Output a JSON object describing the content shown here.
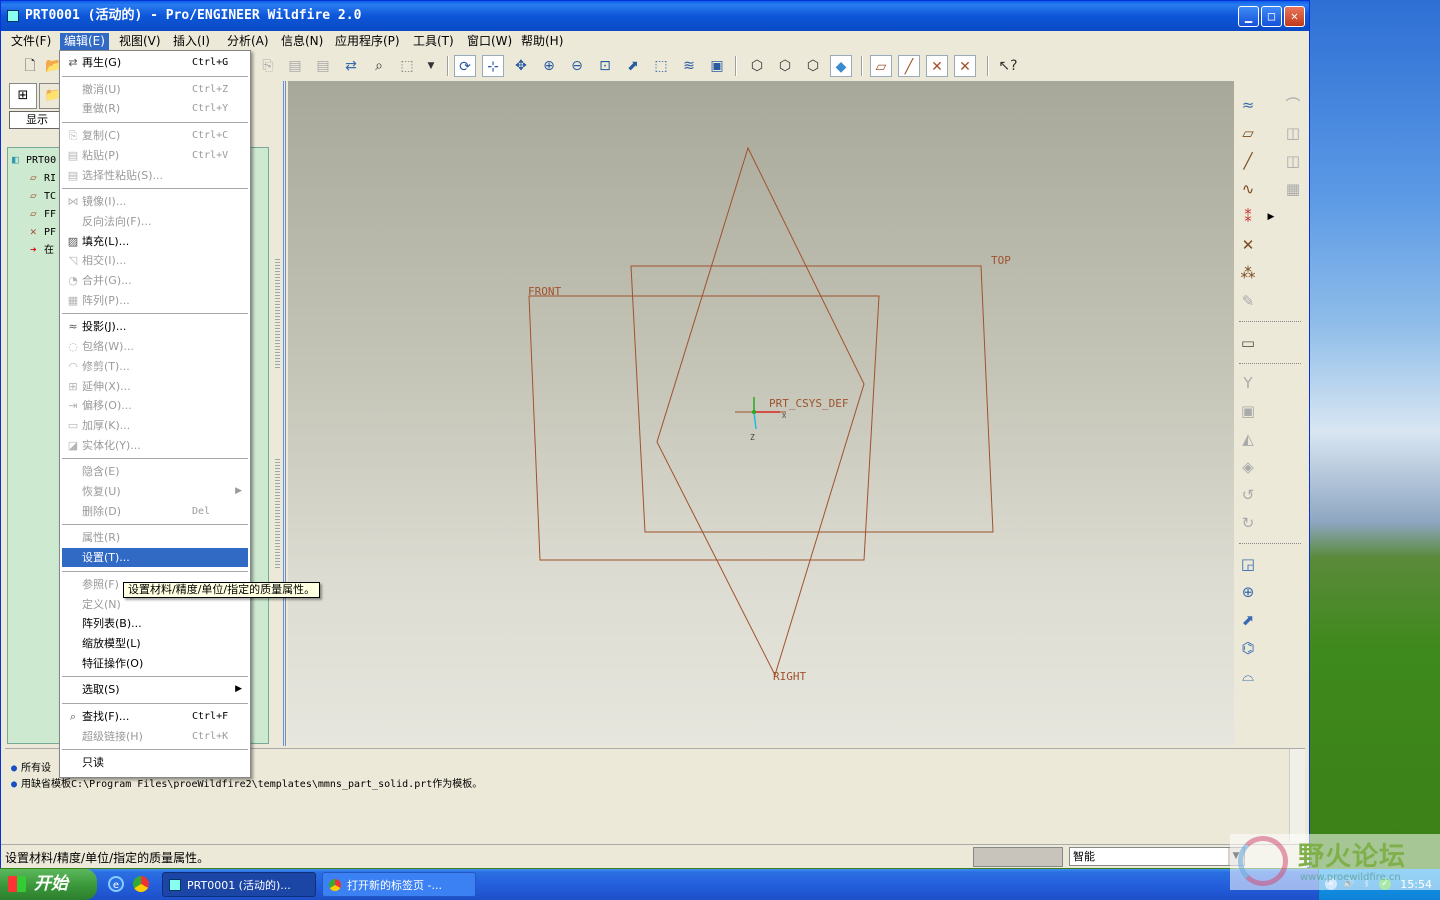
{
  "window": {
    "title": "PRT0001 (活动的) - Pro/ENGINEER Wildfire 2.0",
    "min": "▁",
    "max": "□",
    "close": "✕"
  },
  "menubar": [
    "文件(F)",
    "编辑(E)",
    "视图(V)",
    "插入(I)",
    "分析(A)",
    "信息(N)",
    "应用程序(P)",
    "工具(T)",
    "窗口(W)",
    "帮助(H)"
  ],
  "left_panel": {
    "show_button": "显示",
    "tree": [
      {
        "icon": "part-icon",
        "glyph": "◧",
        "label": "PRT00"
      },
      {
        "icon": "datum-plane-icon",
        "glyph": "▱",
        "label": "RI"
      },
      {
        "icon": "datum-plane-icon",
        "glyph": "▱",
        "label": "TC"
      },
      {
        "icon": "datum-plane-icon",
        "glyph": "▱",
        "label": "FF"
      },
      {
        "icon": "csys-icon",
        "glyph": "✕",
        "label": "PF"
      },
      {
        "icon": "insert-here-arrow-icon",
        "glyph": "➔",
        "label": "在"
      }
    ]
  },
  "edit_menu": [
    {
      "type": "item",
      "icon": "regenerate-icon",
      "glyph": "⇄",
      "label": "再生(G)",
      "shortcut": "Ctrl+G",
      "enabled": true
    },
    {
      "type": "sep"
    },
    {
      "type": "item",
      "icon": "",
      "glyph": "",
      "label": "撤消(U)",
      "shortcut": "Ctrl+Z",
      "enabled": false
    },
    {
      "type": "item",
      "icon": "",
      "glyph": "",
      "label": "重做(R)",
      "shortcut": "Ctrl+Y",
      "enabled": false
    },
    {
      "type": "sep"
    },
    {
      "type": "item",
      "icon": "copy-icon",
      "glyph": "⎘",
      "label": "复制(C)",
      "shortcut": "Ctrl+C",
      "enabled": false
    },
    {
      "type": "item",
      "icon": "paste-icon",
      "glyph": "▤",
      "label": "粘贴(P)",
      "shortcut": "Ctrl+V",
      "enabled": false
    },
    {
      "type": "item",
      "icon": "paste-special-icon",
      "glyph": "▤",
      "label": "选择性粘贴(S)...",
      "shortcut": "",
      "enabled": false
    },
    {
      "type": "sep"
    },
    {
      "type": "item",
      "icon": "mirror-icon",
      "glyph": "⋈",
      "label": "镜像(I)...",
      "shortcut": "",
      "enabled": false
    },
    {
      "type": "item",
      "icon": "",
      "glyph": "",
      "label": "反向法向(F)...",
      "shortcut": "",
      "enabled": false
    },
    {
      "type": "item",
      "icon": "fill-icon",
      "glyph": "▨",
      "label": "填充(L)...",
      "shortcut": "",
      "enabled": true
    },
    {
      "type": "item",
      "icon": "intersect-icon",
      "glyph": "◹",
      "label": "相交(I)...",
      "shortcut": "",
      "enabled": false
    },
    {
      "type": "item",
      "icon": "merge-icon",
      "glyph": "◔",
      "label": "合并(G)...",
      "shortcut": "",
      "enabled": false
    },
    {
      "type": "item",
      "icon": "pattern-icon",
      "glyph": "▦",
      "label": "阵列(P)...",
      "shortcut": "",
      "enabled": false
    },
    {
      "type": "sep"
    },
    {
      "type": "item",
      "icon": "project-icon",
      "glyph": "≈",
      "label": "投影(J)...",
      "shortcut": "",
      "enabled": true
    },
    {
      "type": "item",
      "icon": "wrap-icon",
      "glyph": "◌",
      "label": "包络(W)...",
      "shortcut": "",
      "enabled": false
    },
    {
      "type": "item",
      "icon": "trim-icon",
      "glyph": "◠",
      "label": "修剪(T)...",
      "shortcut": "",
      "enabled": false
    },
    {
      "type": "item",
      "icon": "extend-icon",
      "glyph": "⊞",
      "label": "延伸(X)...",
      "shortcut": "",
      "enabled": false
    },
    {
      "type": "item",
      "icon": "offset-icon",
      "glyph": "⇥",
      "label": "偏移(O)...",
      "shortcut": "",
      "enabled": false
    },
    {
      "type": "item",
      "icon": "thicken-icon",
      "glyph": "▭",
      "label": "加厚(K)...",
      "shortcut": "",
      "enabled": false
    },
    {
      "type": "item",
      "icon": "solidify-icon",
      "glyph": "◪",
      "label": "实体化(Y)...",
      "shortcut": "",
      "enabled": false
    },
    {
      "type": "sep"
    },
    {
      "type": "item",
      "icon": "",
      "glyph": "",
      "label": "隐含(E)",
      "shortcut": "",
      "enabled": false
    },
    {
      "type": "item",
      "icon": "",
      "glyph": "",
      "label": "恢复(U)",
      "shortcut": "",
      "enabled": false,
      "submenu": true
    },
    {
      "type": "item",
      "icon": "",
      "glyph": "",
      "label": "删除(D)",
      "shortcut": "Del",
      "enabled": false
    },
    {
      "type": "sep"
    },
    {
      "type": "item",
      "icon": "",
      "glyph": "",
      "label": "属性(R)",
      "shortcut": "",
      "enabled": false
    },
    {
      "type": "item",
      "icon": "",
      "glyph": "",
      "label": "设置(T)...",
      "shortcut": "",
      "enabled": true,
      "highlighted": true
    },
    {
      "type": "sep"
    },
    {
      "type": "item",
      "icon": "",
      "glyph": "",
      "label": "参照(F)",
      "shortcut": "",
      "enabled": false
    },
    {
      "type": "item",
      "icon": "",
      "glyph": "",
      "label": "定义(N)",
      "shortcut": "",
      "enabled": false
    },
    {
      "type": "item",
      "icon": "",
      "glyph": "",
      "label": "阵列表(B)...",
      "shortcut": "",
      "enabled": true
    },
    {
      "type": "item",
      "icon": "",
      "glyph": "",
      "label": "缩放模型(L)",
      "shortcut": "",
      "enabled": true
    },
    {
      "type": "item",
      "icon": "",
      "glyph": "",
      "label": "特征操作(O)",
      "shortcut": "",
      "enabled": true
    },
    {
      "type": "sep"
    },
    {
      "type": "item",
      "icon": "",
      "glyph": "",
      "label": "选取(S)",
      "shortcut": "",
      "enabled": true,
      "submenu": true
    },
    {
      "type": "sep"
    },
    {
      "type": "item",
      "icon": "find-icon",
      "glyph": "⌕",
      "label": "查找(F)...",
      "shortcut": "Ctrl+F",
      "enabled": true
    },
    {
      "type": "item",
      "icon": "",
      "glyph": "",
      "label": "超级链接(H)",
      "shortcut": "Ctrl+K",
      "enabled": false
    },
    {
      "type": "sep"
    },
    {
      "type": "item",
      "icon": "",
      "glyph": "",
      "label": "只读",
      "shortcut": "",
      "enabled": true
    }
  ],
  "tooltip": "设置材料/精度/单位/指定的质量属性。",
  "graphics": {
    "datum_labels": {
      "front": "FRONT",
      "top": "TOP",
      "right": "RIGHT",
      "csys": "PRT_CSYS_DEF",
      "x_axis": "X",
      "z_axis": "Z"
    },
    "datum_color": "#a0522d"
  },
  "messages": [
    "所有设",
    "用缺省模板C:\\Program Files\\proeWildfire2\\templates\\mmns_part_solid.prt作为模板。"
  ],
  "status": {
    "text": "设置材料/精度/单位/指定的质量属性。",
    "filter": "智能"
  },
  "taskbar": {
    "start": "开始",
    "tasks": [
      {
        "label": "PRT0001 (活动的)...",
        "active": true
      },
      {
        "label": "打开新的标签页 -...",
        "active": false
      }
    ],
    "clock": "15:54"
  },
  "watermark": {
    "text": "野火论坛",
    "url": "www.proewildfire.cn"
  }
}
